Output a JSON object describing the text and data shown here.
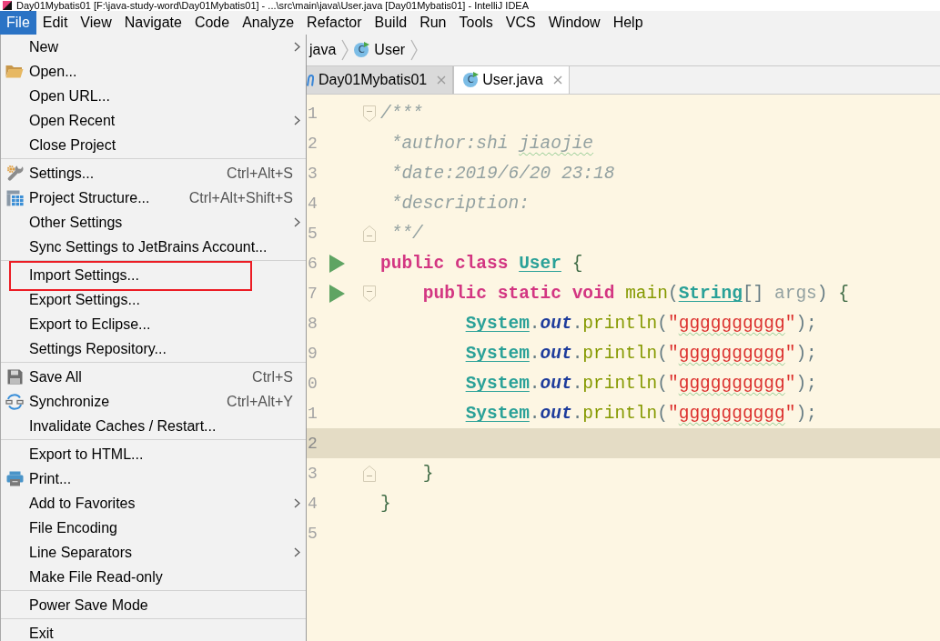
{
  "window": {
    "title": "Day01Mybatis01 [F:\\java-study-word\\Day01Mybatis01] - ...\\src\\main\\java\\User.java [Day01Mybatis01] - IntelliJ IDEA"
  },
  "menu_bar": [
    {
      "label": "File",
      "selected": true
    },
    {
      "label": "Edit",
      "selected": false
    },
    {
      "label": "View",
      "selected": false
    },
    {
      "label": "Navigate",
      "selected": false
    },
    {
      "label": "Code",
      "selected": false
    },
    {
      "label": "Analyze",
      "selected": false
    },
    {
      "label": "Refactor",
      "selected": false
    },
    {
      "label": "Build",
      "selected": false
    },
    {
      "label": "Run",
      "selected": false
    },
    {
      "label": "Tools",
      "selected": false
    },
    {
      "label": "VCS",
      "selected": false
    },
    {
      "label": "Window",
      "selected": false
    },
    {
      "label": "Help",
      "selected": false
    }
  ],
  "file_menu": {
    "sections": [
      {
        "items": [
          {
            "label": "New",
            "kind": "plain",
            "submenu": true,
            "outlined": false
          },
          {
            "label": "Open...",
            "kind": "folder",
            "submenu": false,
            "outlined": false
          },
          {
            "label": "Open URL...",
            "kind": "plain",
            "submenu": false,
            "outlined": false
          },
          {
            "label": "Open Recent",
            "kind": "plain",
            "submenu": true,
            "outlined": false
          },
          {
            "label": "Close Project",
            "kind": "plain",
            "submenu": false,
            "outlined": false
          }
        ]
      },
      {
        "items": [
          {
            "label": "Settings...",
            "kind": "wrench",
            "shortcut": "Ctrl+Alt+S",
            "submenu": false,
            "outlined": false
          },
          {
            "label": "Project Structure...",
            "kind": "grid",
            "shortcut": "Ctrl+Alt+Shift+S",
            "submenu": false,
            "outlined": false
          },
          {
            "label": "Other Settings",
            "kind": "plain",
            "submenu": true,
            "outlined": false
          },
          {
            "label": "Sync Settings to JetBrains Account...",
            "kind": "plain",
            "submenu": false,
            "outlined": false
          }
        ]
      },
      {
        "items": [
          {
            "label": "Import Settings...",
            "kind": "plain",
            "submenu": false,
            "outlined": true
          },
          {
            "label": "Export Settings...",
            "kind": "plain",
            "submenu": false,
            "outlined": false
          },
          {
            "label": "Export to Eclipse...",
            "kind": "plain",
            "submenu": false,
            "outlined": false
          },
          {
            "label": "Settings Repository...",
            "kind": "plain",
            "submenu": false,
            "outlined": false
          }
        ]
      },
      {
        "items": [
          {
            "label": "Save All",
            "kind": "save",
            "shortcut": "Ctrl+S",
            "submenu": false,
            "outlined": false
          },
          {
            "label": "Synchronize",
            "kind": "sync",
            "shortcut": "Ctrl+Alt+Y",
            "submenu": false,
            "outlined": false
          },
          {
            "label": "Invalidate Caches / Restart...",
            "kind": "plain",
            "submenu": false,
            "outlined": false
          }
        ]
      },
      {
        "items": [
          {
            "label": "Export to HTML...",
            "kind": "plain",
            "submenu": false,
            "outlined": false
          },
          {
            "label": "Print...",
            "kind": "printer",
            "submenu": false,
            "outlined": false
          },
          {
            "label": "Add to Favorites",
            "kind": "plain",
            "submenu": true,
            "outlined": false
          },
          {
            "label": "File Encoding",
            "kind": "plain",
            "submenu": false,
            "outlined": false
          },
          {
            "label": "Line Separators",
            "kind": "plain",
            "submenu": true,
            "outlined": false
          },
          {
            "label": "Make File Read-only",
            "kind": "plain",
            "submenu": false,
            "outlined": false
          }
        ]
      },
      {
        "items": [
          {
            "label": "Power Save Mode",
            "kind": "plain",
            "submenu": false,
            "outlined": false
          }
        ]
      },
      {
        "items": [
          {
            "label": "Exit",
            "kind": "plain",
            "submenu": false,
            "outlined": false
          }
        ]
      }
    ]
  },
  "breadcrumbs": [
    {
      "label": "java"
    },
    {
      "label": "User",
      "icon_text": "C"
    }
  ],
  "tabs": [
    {
      "label": "Day01Mybatis01",
      "kind": "module",
      "selected": false
    },
    {
      "label": "User.java",
      "kind": "class",
      "icon_text": "C",
      "selected": true
    }
  ],
  "editor": {
    "lines": [
      {
        "number": "1",
        "run": false,
        "fold_start": true,
        "fold_end": false,
        "current": false,
        "tokens": [
          {
            "text": "/***",
            "kind": "comment",
            "typo": false
          }
        ]
      },
      {
        "number": "2",
        "run": false,
        "fold_start": false,
        "fold_end": false,
        "current": false,
        "tokens": [
          {
            "text": " *author:shi ",
            "kind": "comment",
            "typo": false
          },
          {
            "text": "jiaojie",
            "kind": "comment",
            "typo": true
          }
        ]
      },
      {
        "number": "3",
        "run": false,
        "fold_start": false,
        "fold_end": false,
        "current": false,
        "tokens": [
          {
            "text": " *date:2019/6/20 23:18",
            "kind": "comment",
            "typo": false
          }
        ]
      },
      {
        "number": "4",
        "run": false,
        "fold_start": false,
        "fold_end": false,
        "current": false,
        "tokens": [
          {
            "text": " *description:",
            "kind": "comment",
            "typo": false
          }
        ]
      },
      {
        "number": "5",
        "run": false,
        "fold_start": false,
        "fold_end": true,
        "current": false,
        "tokens": [
          {
            "text": " **/",
            "kind": "comment",
            "typo": false
          }
        ]
      },
      {
        "number": "6",
        "run": true,
        "fold_start": false,
        "fold_end": false,
        "current": false,
        "tokens": [
          {
            "text": "public class ",
            "kind": "keyword",
            "typo": false
          },
          {
            "text": "User",
            "kind": "class",
            "typo": false
          },
          {
            "text": " {",
            "kind": "brace",
            "typo": false
          }
        ]
      },
      {
        "number": "7",
        "run": true,
        "fold_start": true,
        "fold_end": false,
        "current": false,
        "tokens": [
          {
            "text": "    public static void ",
            "kind": "keyword",
            "typo": false
          },
          {
            "text": "main",
            "kind": "method",
            "typo": false
          },
          {
            "text": "(",
            "kind": "punct",
            "typo": false
          },
          {
            "text": "String",
            "kind": "class",
            "typo": false
          },
          {
            "text": "[] ",
            "kind": "punct",
            "typo": false
          },
          {
            "text": "args",
            "kind": "param",
            "typo": false
          },
          {
            "text": ") ",
            "kind": "punct",
            "typo": false
          },
          {
            "text": "{",
            "kind": "brace",
            "typo": false
          }
        ]
      },
      {
        "number": "8",
        "run": false,
        "fold_start": false,
        "fold_end": false,
        "current": false,
        "tokens": [
          {
            "text": "        System",
            "kind": "class",
            "typo": false
          },
          {
            "text": ".",
            "kind": "punct",
            "typo": false
          },
          {
            "text": "out",
            "kind": "field",
            "typo": false
          },
          {
            "text": ".",
            "kind": "punct",
            "typo": false
          },
          {
            "text": "println",
            "kind": "method",
            "typo": false
          },
          {
            "text": "(",
            "kind": "punct",
            "typo": false
          },
          {
            "text": "\"",
            "kind": "string",
            "typo": false
          },
          {
            "text": "gggggggggg",
            "kind": "string",
            "typo": true
          },
          {
            "text": "\"",
            "kind": "string",
            "typo": false
          },
          {
            "text": ");",
            "kind": "punct",
            "typo": false
          }
        ]
      },
      {
        "number": "9",
        "run": false,
        "fold_start": false,
        "fold_end": false,
        "current": false,
        "tokens": [
          {
            "text": "        System",
            "kind": "class",
            "typo": false
          },
          {
            "text": ".",
            "kind": "punct",
            "typo": false
          },
          {
            "text": "out",
            "kind": "field",
            "typo": false
          },
          {
            "text": ".",
            "kind": "punct",
            "typo": false
          },
          {
            "text": "println",
            "kind": "method",
            "typo": false
          },
          {
            "text": "(",
            "kind": "punct",
            "typo": false
          },
          {
            "text": "\"",
            "kind": "string",
            "typo": false
          },
          {
            "text": "gggggggggg",
            "kind": "string",
            "typo": true
          },
          {
            "text": "\"",
            "kind": "string",
            "typo": false
          },
          {
            "text": ");",
            "kind": "punct",
            "typo": false
          }
        ]
      },
      {
        "number": "0",
        "run": false,
        "fold_start": false,
        "fold_end": false,
        "current": false,
        "tokens": [
          {
            "text": "        System",
            "kind": "class",
            "typo": false
          },
          {
            "text": ".",
            "kind": "punct",
            "typo": false
          },
          {
            "text": "out",
            "kind": "field",
            "typo": false
          },
          {
            "text": ".",
            "kind": "punct",
            "typo": false
          },
          {
            "text": "println",
            "kind": "method",
            "typo": false
          },
          {
            "text": "(",
            "kind": "punct",
            "typo": false
          },
          {
            "text": "\"",
            "kind": "string",
            "typo": false
          },
          {
            "text": "gggggggggg",
            "kind": "string",
            "typo": true
          },
          {
            "text": "\"",
            "kind": "string",
            "typo": false
          },
          {
            "text": ");",
            "kind": "punct",
            "typo": false
          }
        ]
      },
      {
        "number": "1",
        "run": false,
        "fold_start": false,
        "fold_end": false,
        "current": false,
        "tokens": [
          {
            "text": "        System",
            "kind": "class",
            "typo": false
          },
          {
            "text": ".",
            "kind": "punct",
            "typo": false
          },
          {
            "text": "out",
            "kind": "field",
            "typo": false
          },
          {
            "text": ".",
            "kind": "punct",
            "typo": false
          },
          {
            "text": "println",
            "kind": "method",
            "typo": false
          },
          {
            "text": "(",
            "kind": "punct",
            "typo": false
          },
          {
            "text": "\"",
            "kind": "string",
            "typo": false
          },
          {
            "text": "gggggggggg",
            "kind": "string",
            "typo": true
          },
          {
            "text": "\"",
            "kind": "string",
            "typo": false
          },
          {
            "text": ");",
            "kind": "punct",
            "typo": false
          }
        ]
      },
      {
        "number": "2",
        "run": false,
        "fold_start": false,
        "fold_end": false,
        "current": true
      },
      {
        "number": "3",
        "run": false,
        "fold_start": false,
        "fold_end": true,
        "current": false,
        "tokens": [
          {
            "text": "    }",
            "kind": "brace",
            "typo": false
          }
        ]
      },
      {
        "number": "4",
        "run": false,
        "fold_start": false,
        "fold_end": false,
        "current": false,
        "tokens": [
          {
            "text": "}",
            "kind": "brace",
            "typo": false
          }
        ]
      },
      {
        "number": "5",
        "run": false,
        "fold_start": false,
        "fold_end": false,
        "current": false
      }
    ]
  }
}
